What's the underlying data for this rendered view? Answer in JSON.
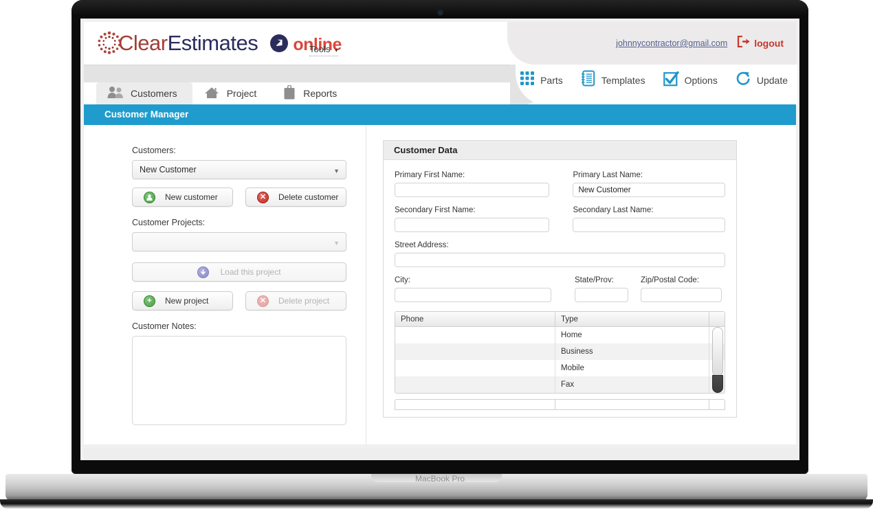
{
  "device": {
    "label": "MacBook Pro"
  },
  "brand": {
    "name_part1": "Clear",
    "name_part2": "Estimates",
    "online": "online",
    "sun_icon": "sun-dots-icon",
    "badge_icon": "arrow-circle-icon",
    "colors": {
      "clear": "#a03f35",
      "estimates": "#2a2d5c",
      "online": "#d9483b",
      "accent_blue": "#1f9ccd"
    }
  },
  "header": {
    "tools_label": "Tools",
    "tools_caret": "▾",
    "user_email": "johnnycontractor@gmail.com",
    "logout_label": "logout",
    "logout_icon": "logout-arrow-icon"
  },
  "icon_nav": [
    {
      "label": "Parts",
      "icon": "grid-squares-icon"
    },
    {
      "label": "Templates",
      "icon": "notebook-icon"
    },
    {
      "label": "Options",
      "icon": "checkbox-check-icon"
    },
    {
      "label": "Update",
      "icon": "refresh-circular-arrow-icon"
    }
  ],
  "tabs": [
    {
      "label": "Customers",
      "icon": "two-people-icon",
      "active": true
    },
    {
      "label": "Project",
      "icon": "house-icon",
      "active": false
    },
    {
      "label": "Reports",
      "icon": "clipboard-icon",
      "active": false
    }
  ],
  "title_bar": {
    "title": "Customer Manager"
  },
  "left_panel": {
    "customers_label": "Customers:",
    "customers_select_value": "New Customer",
    "new_customer_button": "New customer",
    "delete_customer_button": "Delete customer",
    "projects_label": "Customer Projects:",
    "projects_select_value": "",
    "load_project_button": "Load this project",
    "new_project_button": "New project",
    "delete_project_button": "Delete project",
    "notes_label": "Customer Notes:",
    "notes_value": ""
  },
  "customer_data": {
    "panel_title": "Customer Data",
    "fields": {
      "primary_first_name_label": "Primary First Name:",
      "primary_first_name_value": "",
      "primary_last_name_label": "Primary Last Name:",
      "primary_last_name_value": "New Customer",
      "secondary_first_name_label": "Secondary First Name:",
      "secondary_first_name_value": "",
      "secondary_last_name_label": "Secondary Last Name:",
      "secondary_last_name_value": "",
      "street_address_label": "Street Address:",
      "street_address_value": "",
      "city_label": "City:",
      "city_value": "",
      "state_label": "State/Prov:",
      "state_value": "",
      "zip_label": "Zip/Postal Code:",
      "zip_value": ""
    },
    "phone_table": {
      "headers": {
        "phone": "Phone",
        "type": "Type"
      },
      "rows": [
        {
          "phone": "",
          "type": "Home"
        },
        {
          "phone": "",
          "type": "Business"
        },
        {
          "phone": "",
          "type": "Mobile"
        },
        {
          "phone": "",
          "type": "Fax"
        }
      ]
    }
  }
}
